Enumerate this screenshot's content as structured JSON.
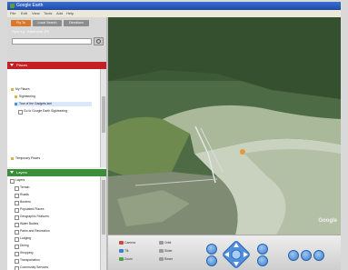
{
  "titlebar": {
    "title": "Google Earth"
  },
  "menu": [
    "File",
    "Edit",
    "View",
    "Tools",
    "Add",
    "Help"
  ],
  "search": {
    "tabs": [
      "Fly To",
      "Local Search",
      "Directions"
    ],
    "prompt": "Fly to e.g., Hotels near JFK",
    "value": ""
  },
  "places": {
    "title": "Places",
    "items": [
      "My Places",
      "Sightseeing",
      "Tour of the Gadgets.kml",
      "Go to Google Earth Sightseeing",
      "Temporary Places"
    ]
  },
  "layers": {
    "title": "Layers",
    "items": [
      "Layers",
      "Terrain",
      "Roads",
      "Borders",
      "Populated Places",
      "Geographic Features",
      "Water Bodies",
      "Parks and Recreation",
      "Lodging",
      "Dining",
      "Shopping",
      "Transportation",
      "Community Services"
    ]
  },
  "map": {
    "logo": "Google"
  },
  "controls": {
    "left": [
      "Camera",
      "Tilt",
      "Zoom"
    ],
    "mid": [
      "Orbit",
      "Slider",
      "Reset"
    ]
  },
  "colors": {
    "title": "#1d4aa8",
    "places": "#c31f24",
    "layers": "#3c8e3a",
    "search_tab": "#d9782b"
  }
}
